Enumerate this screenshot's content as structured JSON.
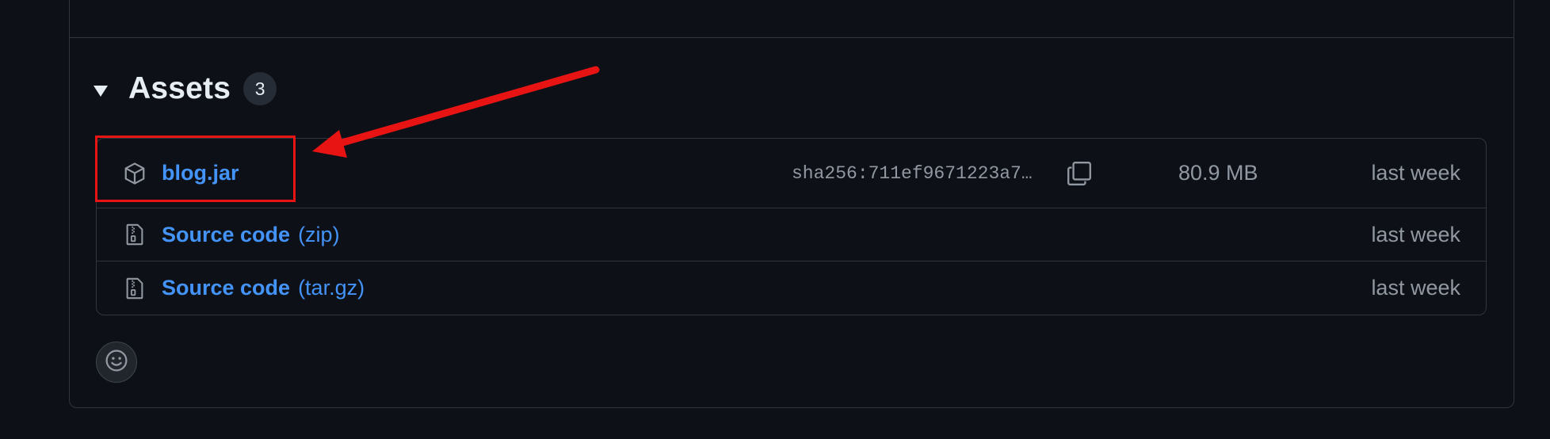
{
  "assets": {
    "title": "Assets",
    "count": "3",
    "collapse_icon": "triangle-down-icon",
    "items": [
      {
        "name": "blog.jar",
        "suffix": "",
        "icon": "package-icon",
        "sha": "sha256:711ef9671223a7…",
        "copy_icon": "copy-icon",
        "size": "80.9 MB",
        "time": "last week"
      },
      {
        "name": "Source code",
        "suffix": "(zip)",
        "icon": "file-zip-icon",
        "time": "last week"
      },
      {
        "name": "Source code",
        "suffix": "(tar.gz)",
        "icon": "file-zip-icon",
        "time": "last week"
      }
    ]
  },
  "reaction": {
    "icon": "smiley-icon"
  },
  "annotation": {
    "color": "#e81414"
  },
  "colors": {
    "background": "#0d1117",
    "link": "#4493f8",
    "muted": "#9198a1",
    "border": "#30363d",
    "text": "#e6edf3"
  }
}
